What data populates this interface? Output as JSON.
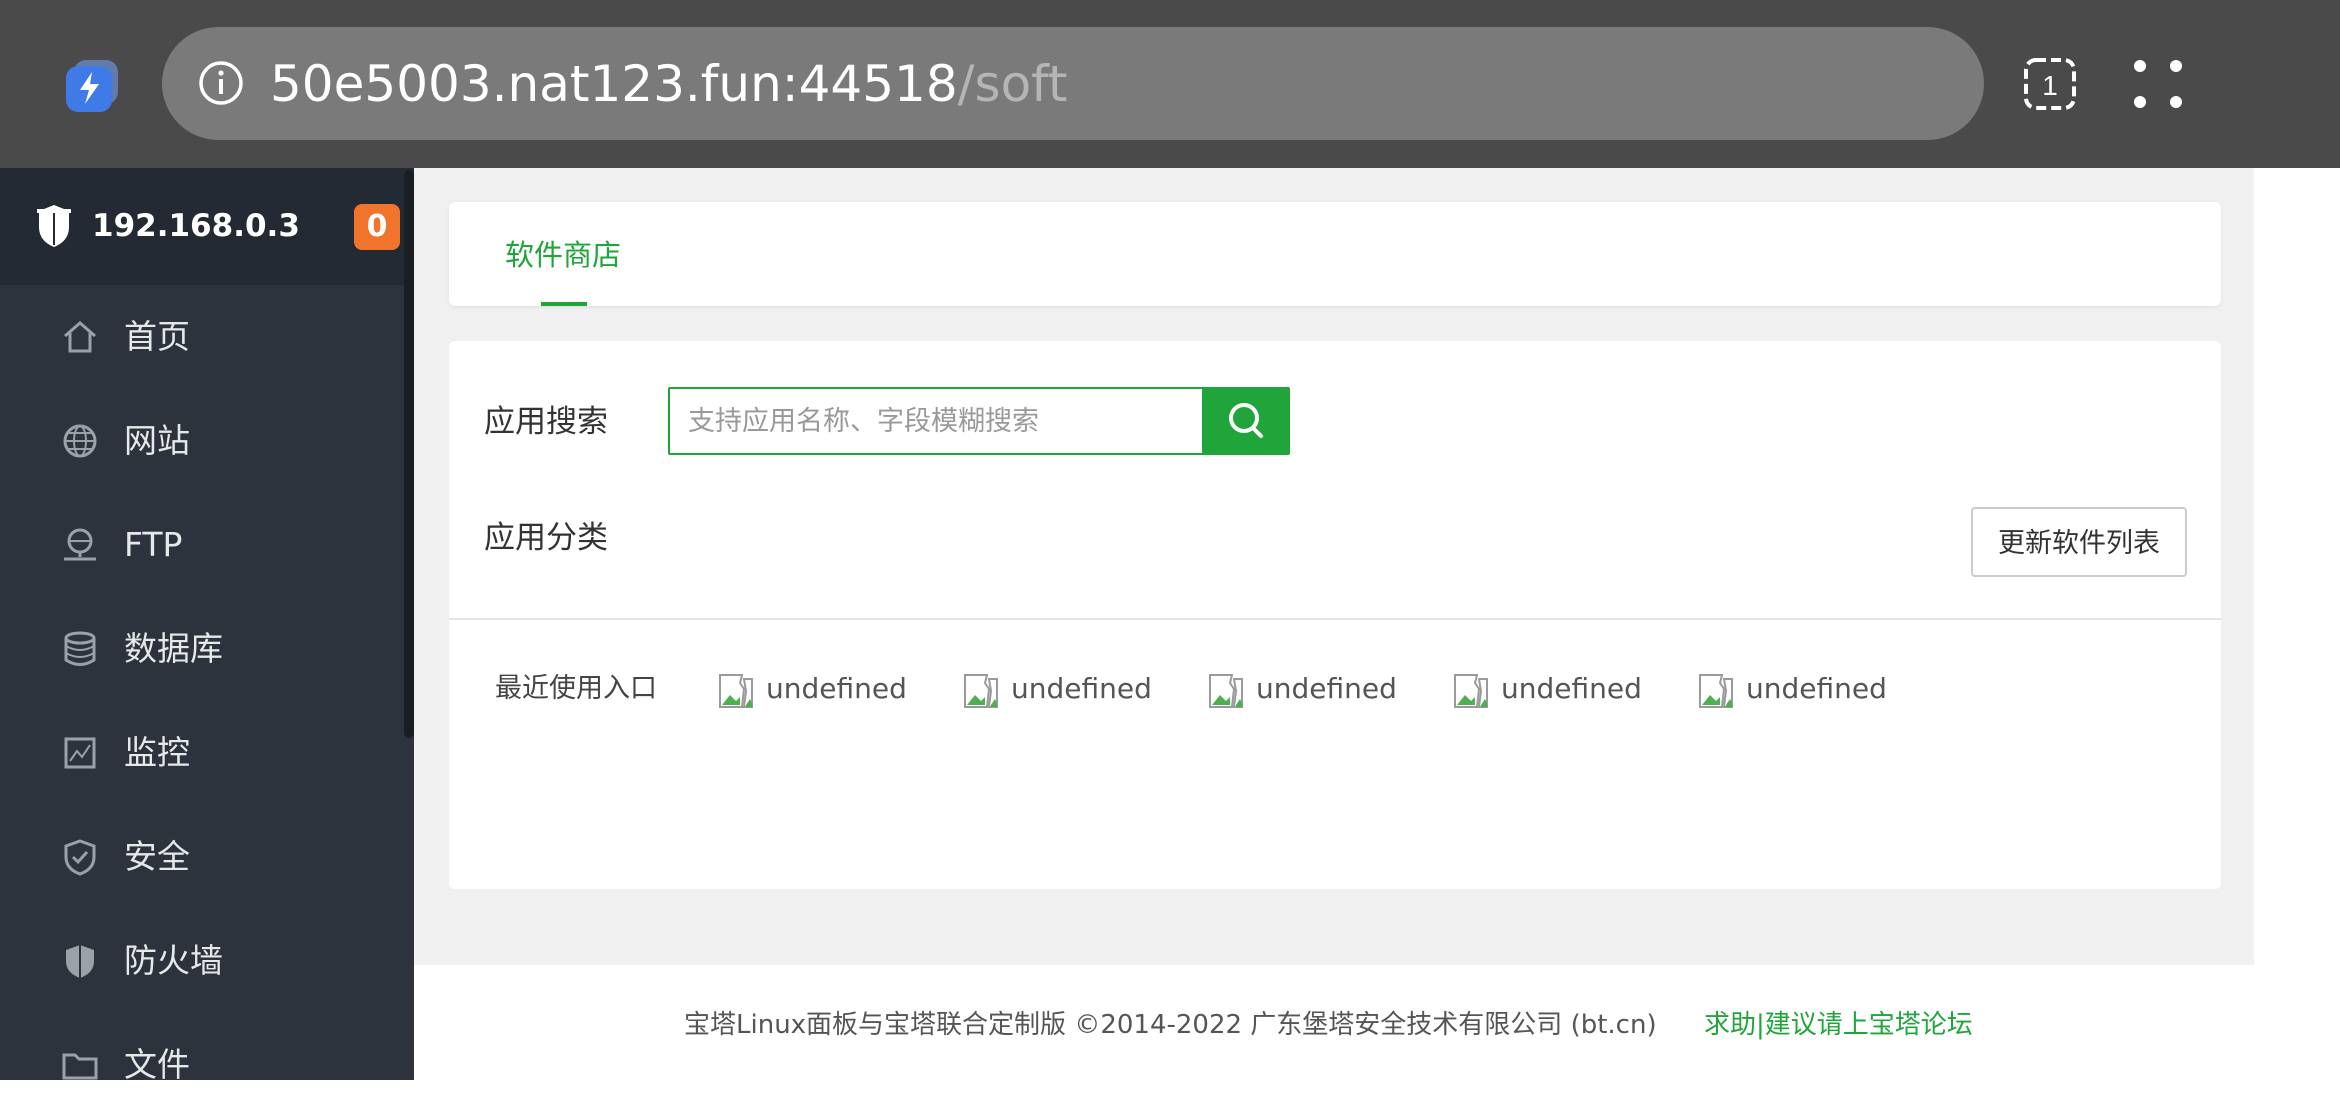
{
  "browser": {
    "url_host": "50e5003.nat123.fun:44518",
    "url_path": "/soft",
    "tab_count": "1"
  },
  "sidebar": {
    "server_ip": "192.168.0.3",
    "badge_count": "0",
    "items": [
      {
        "label": "首页",
        "icon": "home-icon"
      },
      {
        "label": "网站",
        "icon": "globe-icon"
      },
      {
        "label": "FTP",
        "icon": "ftp-icon"
      },
      {
        "label": "数据库",
        "icon": "database-icon"
      },
      {
        "label": "监控",
        "icon": "monitor-icon"
      },
      {
        "label": "安全",
        "icon": "shield-check-icon"
      },
      {
        "label": "防火墙",
        "icon": "firewall-icon"
      },
      {
        "label": "文件",
        "icon": "folder-icon"
      }
    ]
  },
  "tabs": {
    "active_label": "软件商店"
  },
  "search": {
    "label": "应用搜索",
    "placeholder": "支持应用名称、字段模糊搜索"
  },
  "category": {
    "label": "应用分类",
    "update_button": "更新软件列表"
  },
  "recent": {
    "label": "最近使用入口",
    "items": [
      "undefined",
      "undefined",
      "undefined",
      "undefined",
      "undefined"
    ]
  },
  "footer": {
    "copyright": "宝塔Linux面板与宝塔联合定制版 ©2014-2022 广东堡塔安全技术有限公司 (bt.cn)",
    "forum_link": "求助|建议请上宝塔论坛"
  },
  "colors": {
    "accent": "#20a53a",
    "sidebar_bg": "#2c333d",
    "badge": "#f0742b",
    "browser_bar": "#4a4a4a"
  }
}
